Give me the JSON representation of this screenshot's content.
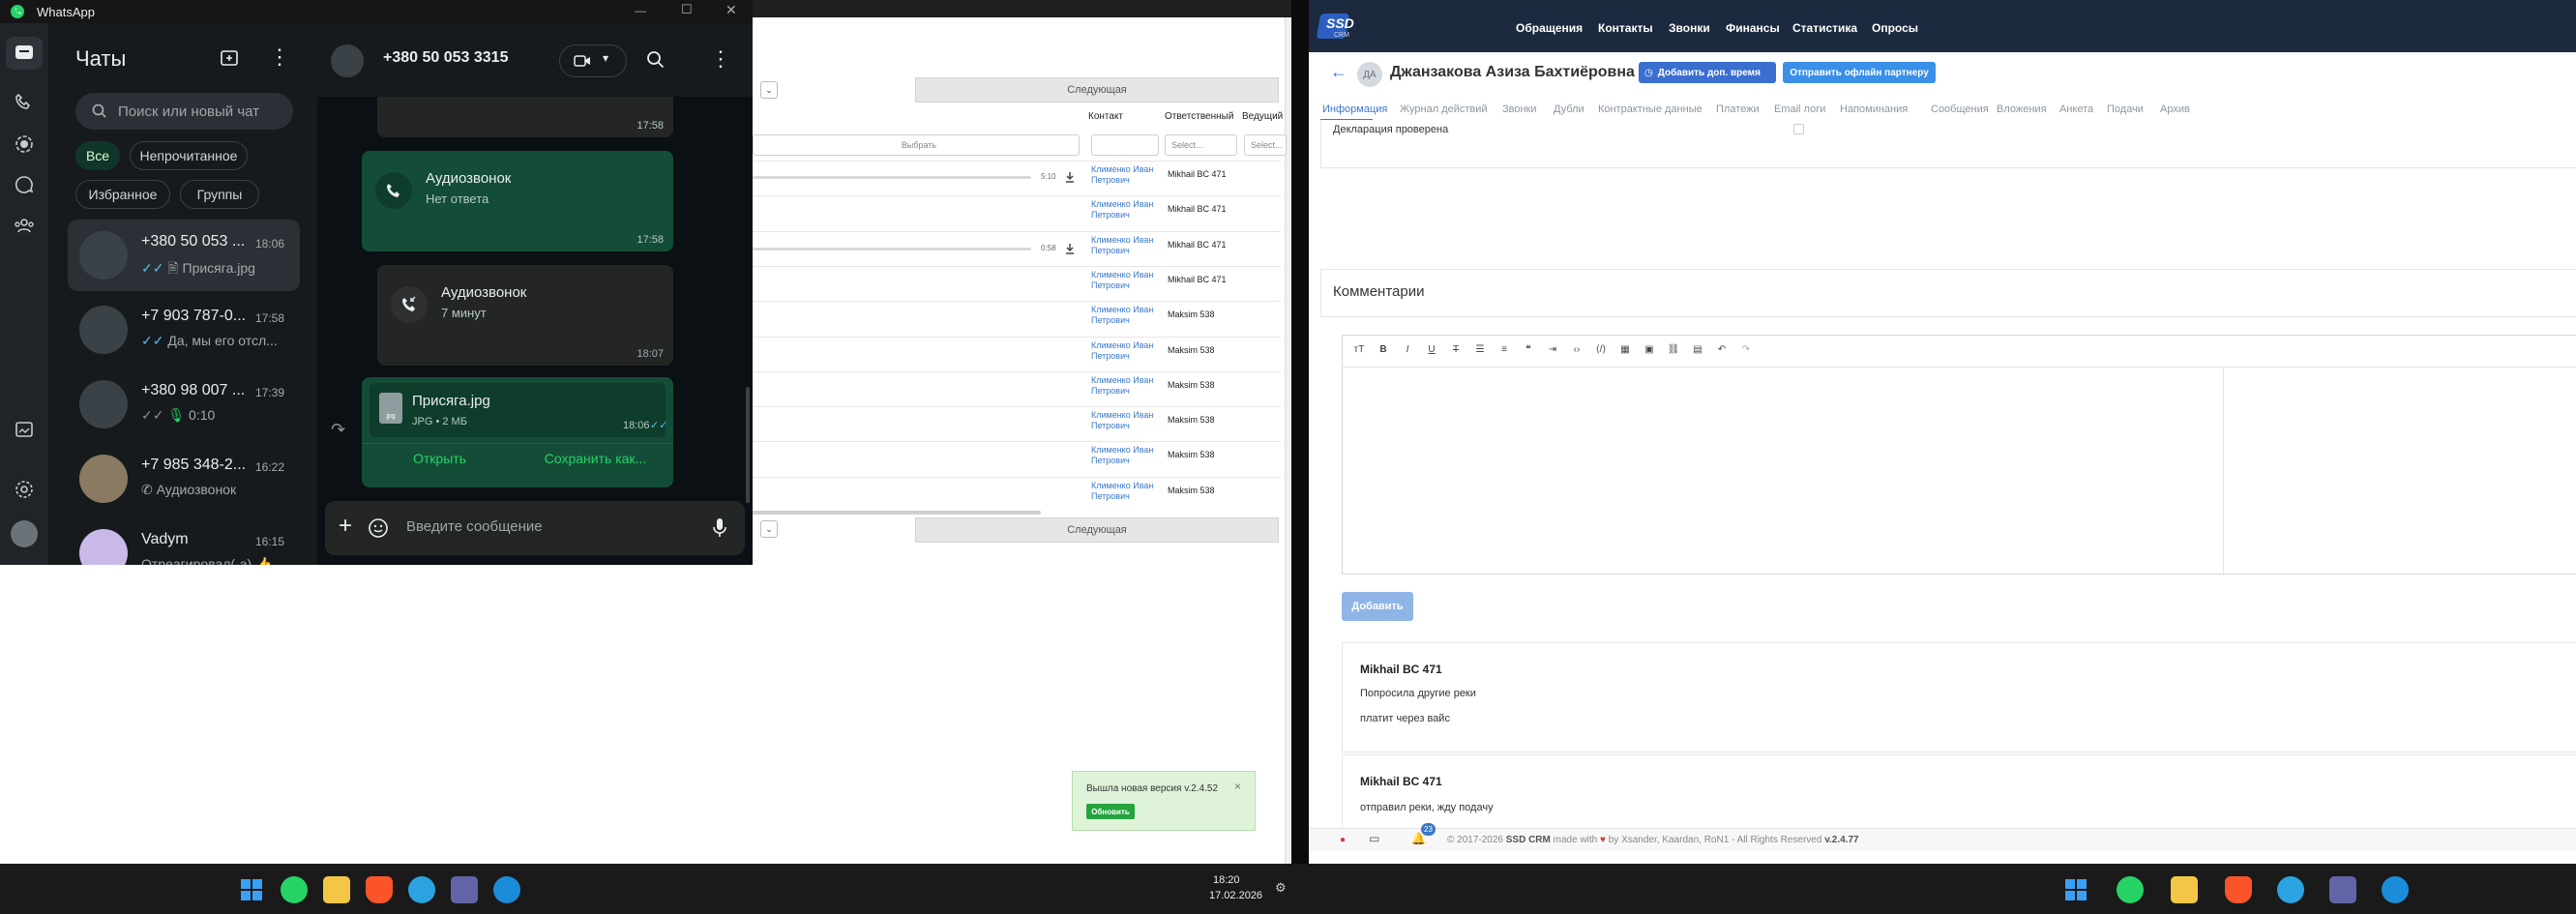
{
  "left_crm": {
    "select_placeholder": "Выбрать",
    "next_label": "Следующая",
    "col_contact": "Контакт",
    "col_responsible": "Ответственный",
    "col_lead": "Ведущий",
    "select_short": "Select...",
    "rows": [
      {
        "contact": "Клименко Иван Петрович",
        "responsible": "Mikhail BC 471"
      },
      {
        "contact": "Клименко Иван Петрович",
        "responsible": "Mikhail BC 471"
      },
      {
        "contact": "Клименко Иван Петрович",
        "responsible": "Mikhail BC 471"
      },
      {
        "contact": "Клименко Иван Петрович",
        "responsible": "Mikhail BC 471"
      },
      {
        "contact": "Клименко Иван Петрович",
        "responsible": "Maksim 538"
      },
      {
        "contact": "Клименко Иван Петрович",
        "responsible": "Maksim 538"
      },
      {
        "contact": "Клименко Иван Петрович",
        "responsible": "Maksim 538"
      },
      {
        "contact": "Клименко Иван Петрович",
        "responsible": "Maksim 538"
      },
      {
        "contact": "Клименко Иван Петрович",
        "responsible": "Maksim 538"
      },
      {
        "contact": "Клименко Иван Петрович",
        "responsible": "Maksim 538"
      }
    ],
    "audio": [
      {
        "time": "5:10"
      },
      {
        "time": "0:58"
      }
    ],
    "update_toast": {
      "text": "Вышла новая версия v.2.4.52",
      "button": "Обновить",
      "close": "×"
    }
  },
  "whatsapp": {
    "app_title": "WhatsApp",
    "list_title": "Чаты",
    "search_placeholder": "Поиск или новый чат",
    "filters": [
      "Все",
      "Непрочитанное",
      "Избранное",
      "Группы"
    ],
    "chats": [
      {
        "name": "+380 50 053 ...",
        "time": "18:06",
        "preview": "Присяга.jpg"
      },
      {
        "name": "+7 903 787-0...",
        "time": "17:58",
        "preview": "Да, мы его отсл..."
      },
      {
        "name": "+380 98 007 ...",
        "time": "17:39",
        "preview": "0:10"
      },
      {
        "name": "+7 985 348-2...",
        "time": "16:22",
        "preview": "Аудиозвонок"
      },
      {
        "name": "Vadym",
        "time": "16:15",
        "preview": "Отреагировал(-а) 👍"
      }
    ],
    "conversation": {
      "contact": "+380 50 053 3315",
      "top_time": "17:58",
      "msg1": {
        "title": "Аудиозвонок",
        "sub": "Нет ответа",
        "time": "17:58"
      },
      "msg2": {
        "title": "Аудиозвонок",
        "sub": "7 минут",
        "time": "18:07"
      },
      "msg3": {
        "file": "Присяга.jpg",
        "meta": "JPG • 2 МБ",
        "ext": "jpg",
        "time": "18:06",
        "open": "Открыть",
        "save": "Сохранить как..."
      },
      "input_placeholder": "Введите сообщение"
    }
  },
  "crm": {
    "logo": "SSD",
    "logo_sub": "CRM",
    "nav": [
      "Обращения",
      "Контакты",
      "Звонки",
      "Финансы",
      "Статистика",
      "Опросы"
    ],
    "avatar_initials": "ДА",
    "person_name": "Джанзакова Азиза Бахтиёровна",
    "btn_add_time": "Добавить доп. время",
    "btn_send_partner": "Отправить офлайн партнеру",
    "tabs": [
      "Информация",
      "Журнал действий",
      "Звонки",
      "Дубли",
      "Контрактные данные",
      "Платежи",
      "Email логи",
      "Напоминания",
      "Сообщения",
      "Вложения",
      "Анкета",
      "Подачи",
      "Архив"
    ],
    "declaration": "Декларация проверена",
    "comments_title": "Комментарии",
    "add_button": "Добавить",
    "comments": [
      {
        "author": "Mikhail BC 471",
        "lines": [
          "Попросила другие реки",
          "платит через вайс"
        ]
      },
      {
        "author": "Mikhail BC 471",
        "lines": [
          "отправил реки, жду подачу"
        ]
      }
    ],
    "footer": {
      "copyright": "© 2017-2026",
      "brand": "SSD CRM",
      "made_with": "made with",
      "by": "by Xsander, Kaardan, RoN1 - All Rights Reserved",
      "version": "v.2.4.77",
      "notif_count": "23"
    }
  },
  "taskbar": {
    "time": "18:20",
    "date": "17.02.2026"
  }
}
